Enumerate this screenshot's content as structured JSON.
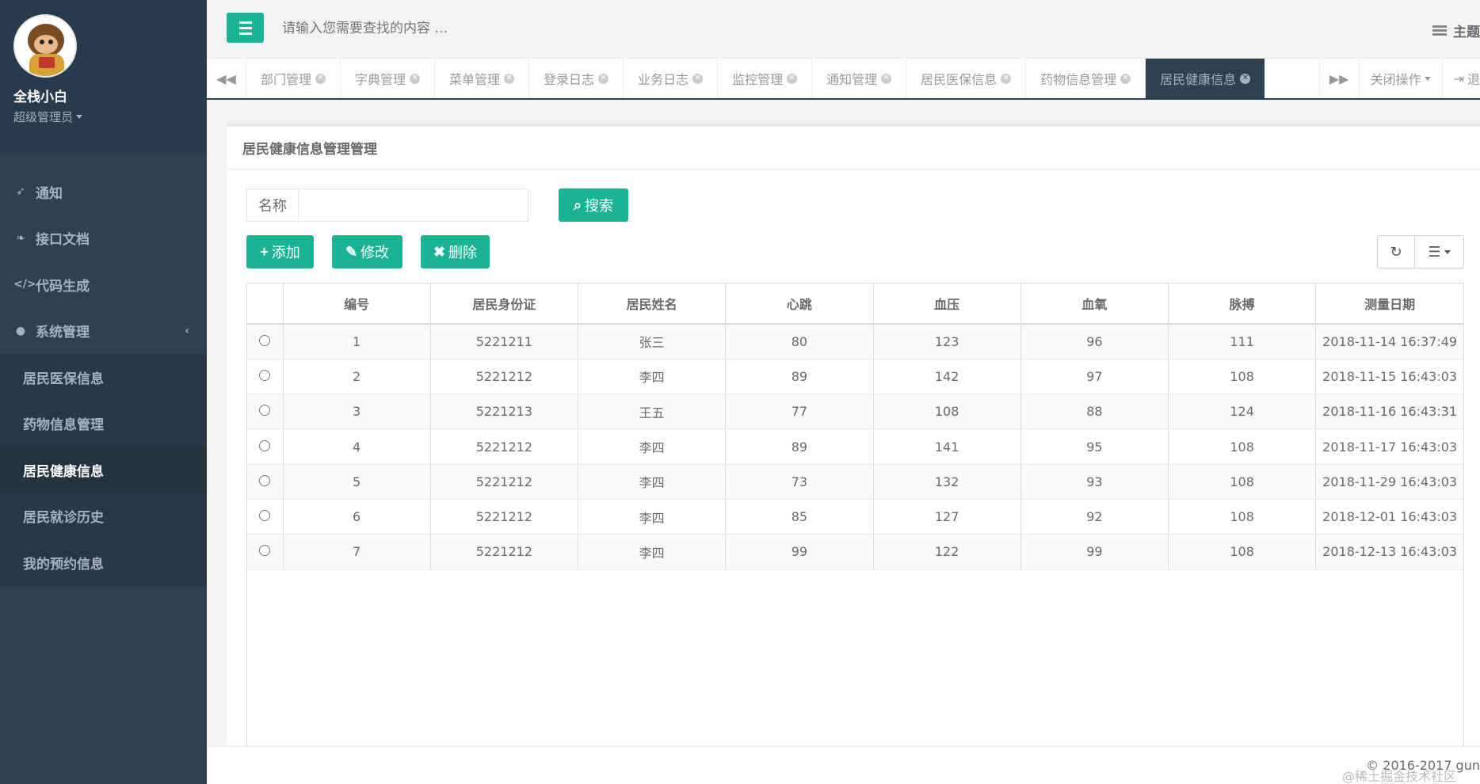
{
  "sidebar": {
    "user_name": "全栈小白",
    "user_role": "超级管理员",
    "items": [
      {
        "label": "通知",
        "icon": "rocket-icon"
      },
      {
        "label": "接口文档",
        "icon": "leaf-icon"
      },
      {
        "label": "代码生成",
        "icon": "code-icon"
      },
      {
        "label": "系统管理",
        "icon": "user-icon"
      },
      {
        "label": "居民医保信息"
      },
      {
        "label": "药物信息管理"
      },
      {
        "label": "居民健康信息"
      },
      {
        "label": "居民就诊历史"
      },
      {
        "label": "我的预约信息"
      }
    ]
  },
  "topbar": {
    "search_placeholder": "请输入您需要查找的内容 …",
    "theme_label": "主题"
  },
  "tabs": [
    {
      "label": "部门管理"
    },
    {
      "label": "字典管理"
    },
    {
      "label": "菜单管理"
    },
    {
      "label": "登录日志"
    },
    {
      "label": "业务日志"
    },
    {
      "label": "监控管理"
    },
    {
      "label": "通知管理"
    },
    {
      "label": "居民医保信息"
    },
    {
      "label": "药物信息管理"
    },
    {
      "label": "居民健康信息"
    }
  ],
  "tab_actions": {
    "close_ops": "关闭操作",
    "exit": "退"
  },
  "panel": {
    "title": "居民健康信息管理管理",
    "filter_label": "名称",
    "search_button": "搜索",
    "add_button": "添加",
    "edit_button": "修改",
    "delete_button": "删除"
  },
  "table": {
    "headers": [
      "编号",
      "居民身份证",
      "居民姓名",
      "心跳",
      "血压",
      "血氧",
      "脉搏",
      "测量日期"
    ],
    "rows": [
      [
        "1",
        "5221211",
        "张三",
        "80",
        "123",
        "96",
        "111",
        "2018-11-14 16:37:49"
      ],
      [
        "2",
        "5221212",
        "李四",
        "89",
        "142",
        "97",
        "108",
        "2018-11-15 16:43:03"
      ],
      [
        "3",
        "5221213",
        "王五",
        "77",
        "108",
        "88",
        "124",
        "2018-11-16 16:43:31"
      ],
      [
        "4",
        "5221212",
        "李四",
        "89",
        "141",
        "95",
        "108",
        "2018-11-17 16:43:03"
      ],
      [
        "5",
        "5221212",
        "李四",
        "73",
        "132",
        "93",
        "108",
        "2018-11-29 16:43:03"
      ],
      [
        "6",
        "5221212",
        "李四",
        "85",
        "127",
        "92",
        "108",
        "2018-12-01 16:43:03"
      ],
      [
        "7",
        "5221212",
        "李四",
        "99",
        "122",
        "99",
        "108",
        "2018-12-13 16:43:03"
      ]
    ]
  },
  "footer": {
    "copyright": "© 2016-2017 gun",
    "watermark": "@稀土掘金技术社区"
  },
  "colors": {
    "primary": "#1ab394",
    "sidebar": "#2f4050"
  }
}
